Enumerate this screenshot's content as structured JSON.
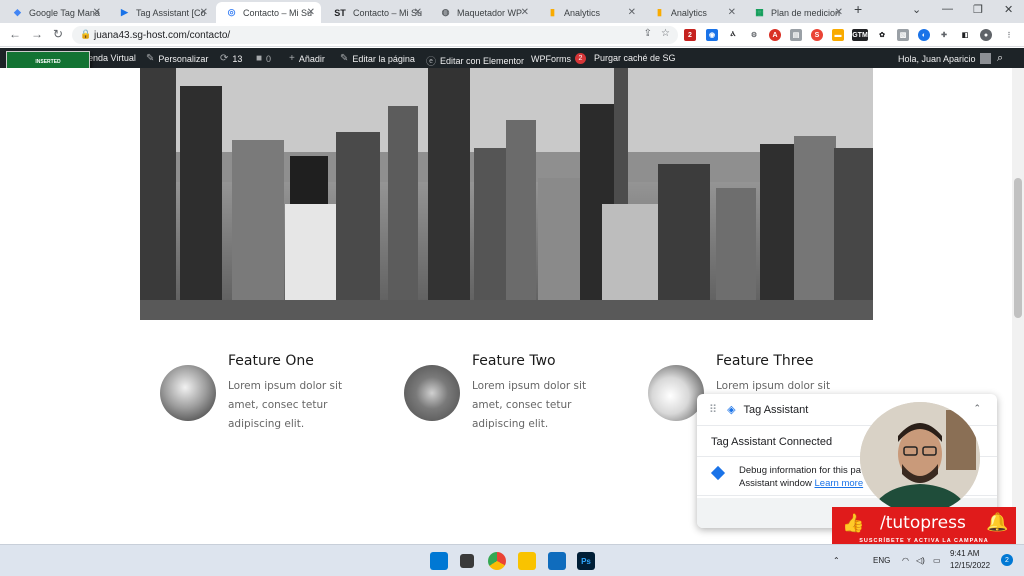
{
  "browser": {
    "tabs": [
      {
        "title": "Google Tag Mana",
        "favicon_color": "#4285f4",
        "favicon": "◆"
      },
      {
        "title": "Tag Assistant [Co",
        "favicon_color": "#1a73e8",
        "favicon": "▶"
      },
      {
        "title": "Contacto – Mi Su",
        "favicon_color": "#4285f4",
        "favicon": "◎"
      },
      {
        "title": "Contacto – Mi Su",
        "favicon_color": "#202124",
        "favicon": "ST"
      },
      {
        "title": "Maquetador WP",
        "favicon_color": "#5f6368",
        "favicon": "◍"
      },
      {
        "title": "Analytics",
        "favicon_color": "#f9ab00",
        "favicon": "▮"
      },
      {
        "title": "Analytics",
        "favicon_color": "#f9ab00",
        "favicon": "▮"
      },
      {
        "title": "Plan de medicion",
        "favicon_color": "#0f9d58",
        "favicon": "▦"
      }
    ],
    "url": "juana43.sg-host.com/contacto/"
  },
  "adminbar": {
    "store": "enda Virtual",
    "customize": "Personalizar",
    "updates": "13",
    "comments": "0",
    "add_new": "Añadir",
    "edit_page": "Editar la página",
    "edit_elementor": "Editar con Elementor",
    "wpforms": "WPForms",
    "wpforms_count": "2",
    "purge": "Purgar caché de SG",
    "greeting": "Hola, Juan Aparicio"
  },
  "gtm": {
    "status": "INSERTED",
    "id": "GTM-MJ7C72R"
  },
  "features": [
    {
      "title": "Feature One",
      "text": "Lorem ipsum dolor sit amet, consec tetur adipiscing elit."
    },
    {
      "title": "Feature Two",
      "text": "Lorem ipsum dolor sit amet, consec tetur adipiscing elit."
    },
    {
      "title": "Feature Three",
      "text": "Lorem ipsum dolor sit"
    }
  ],
  "tag_assistant": {
    "title": "Tag Assistant",
    "connected": "Tag Assistant Connected",
    "info_line1": "Debug information for this pa",
    "info_line2": "Assistant window",
    "learn_more": "Learn more"
  },
  "overlay": {
    "brand": "/tutopress",
    "subtitle": "SUSCRÍBETE Y ACTIVA LA CAMPANA"
  },
  "taskbar": {
    "lang": "ENG",
    "time": "9:41 AM",
    "date": "12/15/2022",
    "notifications": "2"
  }
}
